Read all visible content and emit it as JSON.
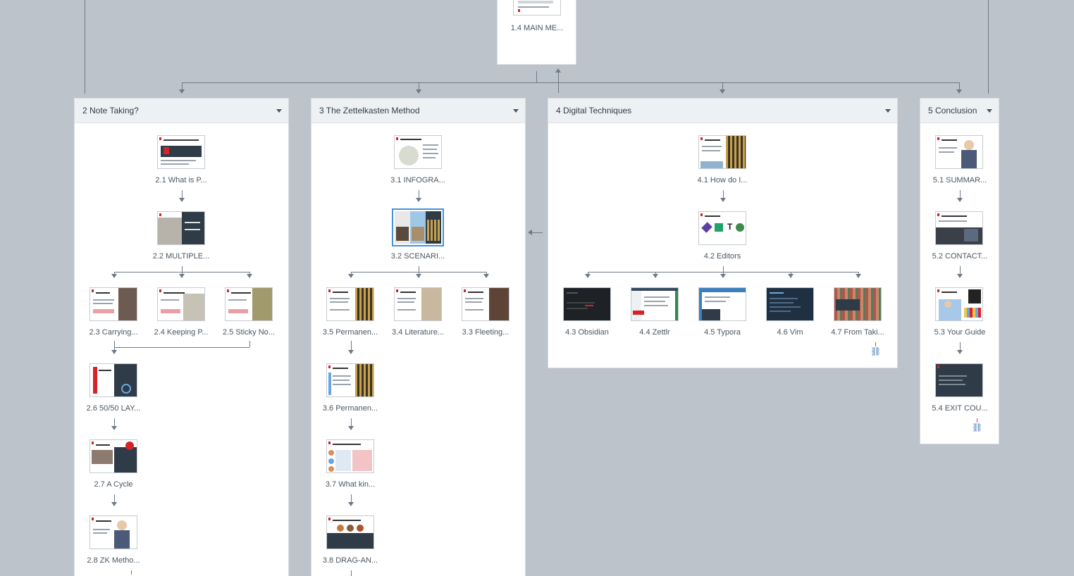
{
  "top_card": {
    "label": "1.4 MAIN ME..."
  },
  "panels": [
    {
      "title": "2 Note Taking?",
      "slides": [
        {
          "label": "2.1 What is P...",
          "theme": "red-dark"
        },
        {
          "label": "2.2 MULTIPLE...",
          "theme": "photo-dark"
        },
        {
          "label": "2.3 Carrying...",
          "theme": "white-photo"
        },
        {
          "label": "2.4 Keeping P...",
          "theme": "white-photo"
        },
        {
          "label": "2.5 Sticky No...",
          "theme": "white-photo"
        },
        {
          "label": "2.6 50/50 LAY...",
          "theme": "red-dark"
        },
        {
          "label": "2.7 A Cycle",
          "theme": "white-dark"
        },
        {
          "label": "2.8 ZK Metho...",
          "theme": "white-person"
        }
      ]
    },
    {
      "title": "3 The Zettelkasten Method",
      "slides": [
        {
          "label": "3.1  INFOGRA...",
          "theme": "infographic"
        },
        {
          "label": "3.2  SCENARI...",
          "theme": "scenario"
        },
        {
          "label": "3.5 Permanen...",
          "theme": "white-grid"
        },
        {
          "label": "3.4 Literature...",
          "theme": "white-photo"
        },
        {
          "label": "3.3 Fleeting...",
          "theme": "white-photo"
        },
        {
          "label": "3.6 Permanen...",
          "theme": "white-grid"
        },
        {
          "label": "3.7 What kin...",
          "theme": "white-table"
        },
        {
          "label": "3.8 DRAG-AN...",
          "theme": "dark"
        }
      ]
    },
    {
      "title": "4 Digital Techniques",
      "slides": [
        {
          "label": "4.1 How do I...",
          "theme": "white-grid"
        },
        {
          "label": "4.2 Editors",
          "theme": "white-icons"
        },
        {
          "label": "4.3 Obsidian",
          "theme": "dark"
        },
        {
          "label": "4.4 Zettlr",
          "theme": "screen"
        },
        {
          "label": "4.5 Typora",
          "theme": "screen-blue"
        },
        {
          "label": "4.6 Vim",
          "theme": "dark-blue"
        },
        {
          "label": "4.7 From Taki...",
          "theme": "books"
        }
      ]
    },
    {
      "title": "5 Conclusion",
      "slides": [
        {
          "label": "5.1 SUMMAR...",
          "theme": "white-person"
        },
        {
          "label": "5.2  CONTACT...",
          "theme": "white-photo"
        },
        {
          "label": "5.3 Your Guide",
          "theme": "white-person"
        },
        {
          "label": "5.4 EXIT COU...",
          "theme": "dark"
        }
      ]
    }
  ],
  "icons": {
    "link": "link-icon",
    "collapse": "chevron-down-icon"
  },
  "colors": {
    "background": "#bcc3cb",
    "selected": "#4a90d9",
    "accent_red": "#d6232a",
    "connector": "#6e7a86"
  }
}
